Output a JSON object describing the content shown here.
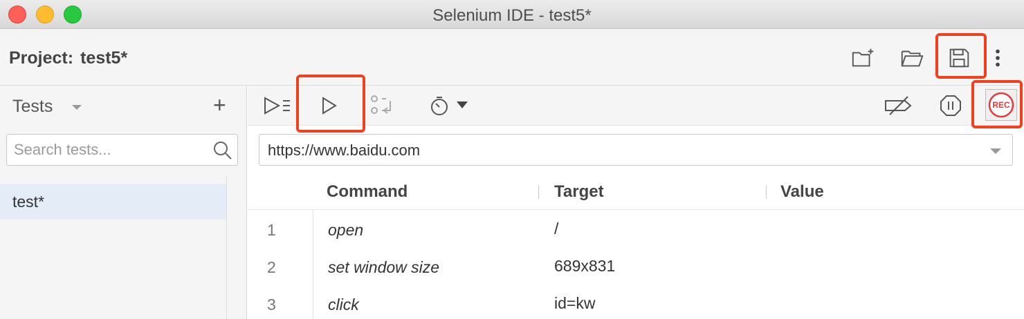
{
  "window": {
    "title": "Selenium IDE - test5*"
  },
  "project": {
    "label": "Project:",
    "name": "test5*",
    "actions": [
      {
        "icon": "new-folder-icon",
        "name": "new-project"
      },
      {
        "icon": "open-folder-icon",
        "name": "open-project"
      },
      {
        "icon": "save-icon",
        "name": "save-project"
      },
      {
        "icon": "more-vertical-icon",
        "name": "more-options"
      }
    ]
  },
  "sidebar": {
    "title": "Tests",
    "add_label": "+",
    "search": {
      "placeholder": "Search tests...",
      "value": ""
    },
    "tests": [
      {
        "name": "test*",
        "selected": true
      }
    ]
  },
  "toolbar": {
    "left": [
      {
        "icon": "run-all-tests-icon"
      },
      {
        "icon": "run-current-test-icon"
      },
      {
        "icon": "step-over-icon"
      },
      {
        "icon": "test-execution-speed-icon"
      }
    ],
    "right": [
      {
        "icon": "disable-breakpoints-icon"
      },
      {
        "icon": "pause-on-exceptions-icon"
      },
      {
        "icon": "record-icon",
        "label": "REC"
      }
    ]
  },
  "url": {
    "value": "https://www.baidu.com"
  },
  "table": {
    "columns": [
      "Command",
      "Target",
      "Value"
    ],
    "rows": [
      {
        "num": "1",
        "command": "open",
        "target": "/",
        "value": ""
      },
      {
        "num": "2",
        "command": "set window size",
        "target": "689x831",
        "value": ""
      },
      {
        "num": "3",
        "command": "click",
        "target": "id=kw",
        "value": ""
      }
    ]
  },
  "colors": {
    "highlight": "#f0401c",
    "record": "#e23b3b",
    "selected_row": "#e4ecf7"
  }
}
